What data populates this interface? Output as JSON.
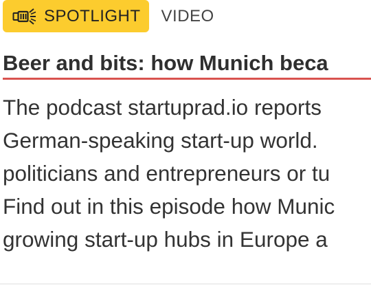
{
  "badge": {
    "icon": "megaphone-icon",
    "label": "SPOTLIGHT",
    "color": "#fccc2e"
  },
  "category": "VIDEO",
  "headline": "Beer and bits: how Munich beca",
  "accent_color": "#d9534f",
  "body_lines": [
    "The podcast startuprad.io reports",
    "German-speaking start-up world.",
    "politicians and entrepreneurs or tu",
    "Find out in this episode how Munic",
    "growing start-up hubs in Europe a"
  ]
}
